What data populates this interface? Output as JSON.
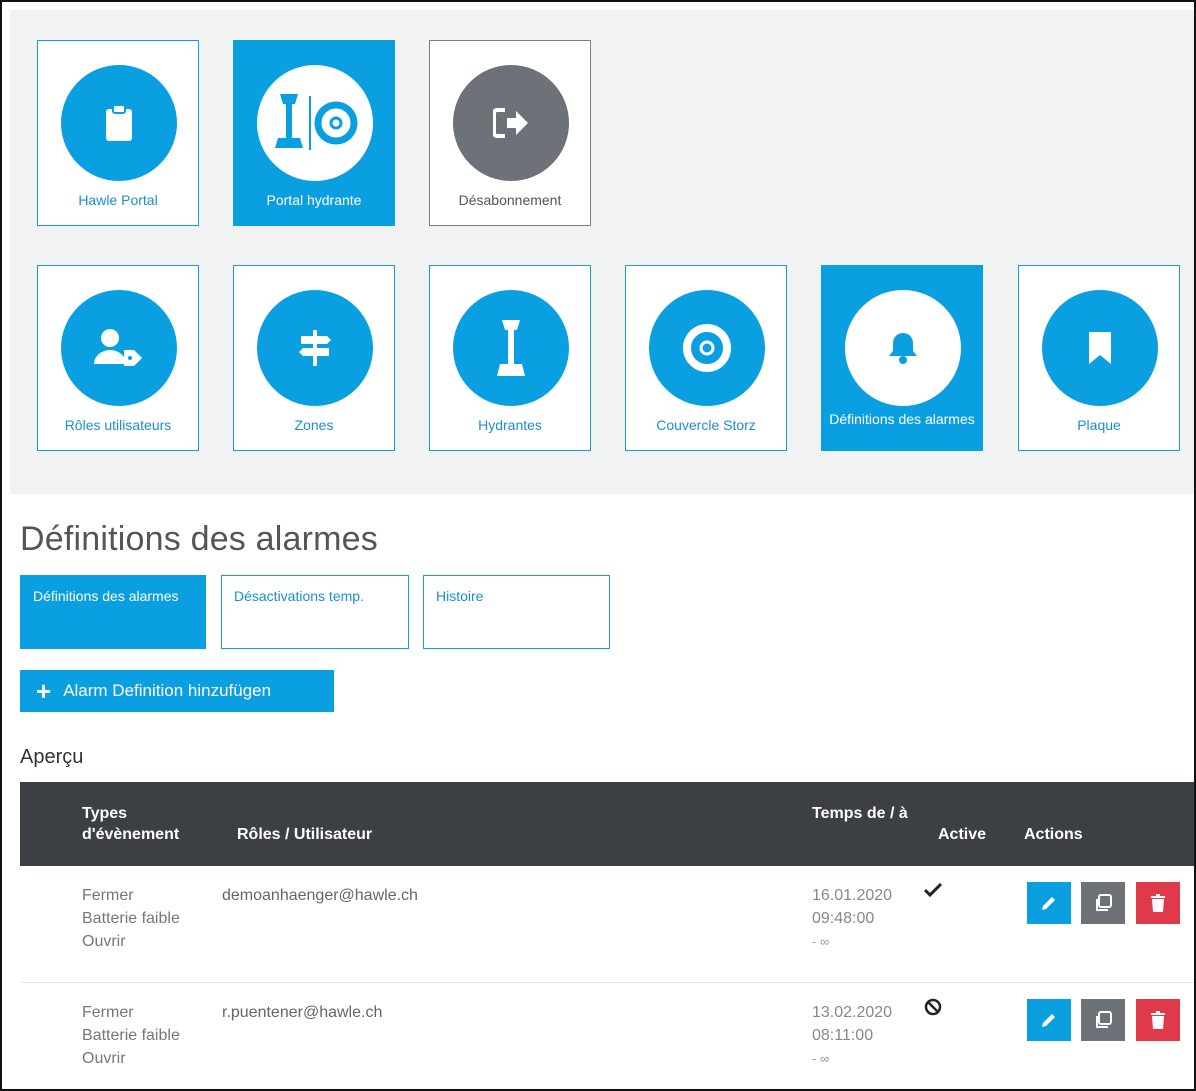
{
  "apps": [
    {
      "label": "Hawle Portal",
      "icon": "clipboard-icon",
      "state": "normal"
    },
    {
      "label": "Portal hydrante",
      "icon": "hydrant-cover-icon",
      "state": "active"
    },
    {
      "label": "Désabonnement",
      "icon": "sign-out-icon",
      "state": "grey"
    }
  ],
  "modules": [
    {
      "label": "Rôles utilisateurs",
      "icon": "user-tag-icon"
    },
    {
      "label": "Zones",
      "icon": "signpost-icon"
    },
    {
      "label": "Hydrantes",
      "icon": "hydrant-icon"
    },
    {
      "label": "Couvercle Storz",
      "icon": "storz-cover-icon"
    },
    {
      "label": "Définitions des alarmes",
      "icon": "bell-icon",
      "active": true
    },
    {
      "label": "Plaque",
      "icon": "bookmark-icon"
    }
  ],
  "page": {
    "title": "Définitions des alarmes",
    "tabs": [
      {
        "label": "Définitions des alarmes",
        "active": true
      },
      {
        "label": "Désactivations temp.",
        "active": false
      },
      {
        "label": "Histoire",
        "active": false
      }
    ],
    "add_button": "Alarm Definition hinzufügen",
    "section_title": "Aperçu"
  },
  "table": {
    "headers": {
      "event_types": "Types d'évènement",
      "roles": "Rôles / Utilisateur",
      "time": "Temps de / à",
      "active": "Active",
      "actions": "Actions"
    },
    "rows": [
      {
        "events": [
          "Fermer",
          "Batterie faible",
          "Ouvrir"
        ],
        "user": "demoanhaenger@hawle.ch",
        "date": "16.01.2020",
        "time": "09:48:00",
        "until": "- ∞",
        "active": true
      },
      {
        "events": [
          "Fermer",
          "Batterie faible",
          "Ouvrir"
        ],
        "user": "r.puentener@hawle.ch",
        "date": "13.02.2020",
        "time": "08:11:00",
        "until": "- ∞",
        "active": false
      }
    ]
  },
  "colors": {
    "primary": "#0a9fe0",
    "grey": "#6c7278",
    "danger": "#e03a4a",
    "header_bg": "#3c3f43"
  }
}
